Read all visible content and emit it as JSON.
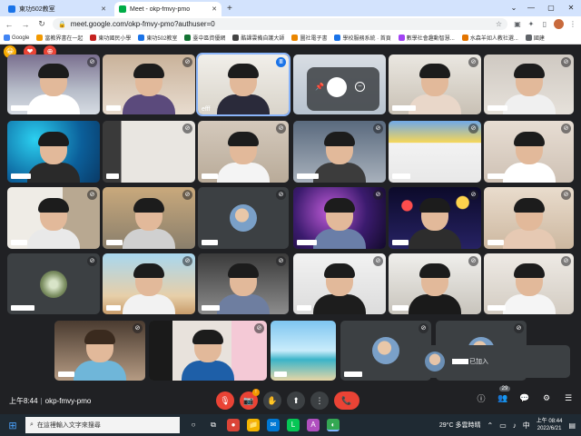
{
  "browser": {
    "tabs": [
      {
        "label": "東功502教室",
        "active": false,
        "icon_color": "#1a73e8"
      },
      {
        "label": "Meet - okp-fmvy-pmo",
        "active": true,
        "icon_color": "#00ac47"
      }
    ],
    "new_tab": "+",
    "window_controls": [
      "⌄",
      "—",
      "▢",
      "✕"
    ],
    "nav": {
      "back": "←",
      "forward": "→",
      "reload": "↻"
    },
    "url": "meet.google.com/okp-fmvy-pmo?authuser=0",
    "bookmarks": [
      {
        "label": "Google",
        "color": "#4285f4"
      },
      {
        "label": "當教界書在一起",
        "color": "#f29900"
      },
      {
        "label": "東功國民小學",
        "color": "#c5221f"
      },
      {
        "label": "東功502教室",
        "color": "#1a73e8"
      },
      {
        "label": "臺中區資優網",
        "color": "#137333"
      },
      {
        "label": "酷課雲備自護大師",
        "color": "#444"
      },
      {
        "label": "圖社電子書",
        "color": "#ea8600"
      },
      {
        "label": "學校服務系統 · 首頁",
        "color": "#1a73e8"
      },
      {
        "label": "數學社會趣動智慧...",
        "color": "#a142f4"
      },
      {
        "label": "水森羊如人教社選...",
        "color": "#e37400"
      },
      {
        "label": "國建",
        "color": "#5f6368"
      }
    ]
  },
  "meet": {
    "time": "上午8:44",
    "meeting_code": "okp-fmvy-pmo",
    "reactions": [
      "😀",
      "❤",
      "⊕"
    ],
    "name_visible": "efff",
    "participant_count": "29",
    "toast_text": "已加入",
    "controls": {
      "mic": "🎙",
      "camera": "📷",
      "camera_badge": "!",
      "hand": "✋",
      "present": "⬆",
      "more": "⋮",
      "end": "📞"
    },
    "right_controls": [
      "ⓘ",
      "👥",
      "💬",
      "⚙",
      "☰"
    ]
  },
  "taskbar": {
    "search_placeholder": "在這裡輸入文字來搜尋",
    "weather": "29°C 多雲時晴",
    "time": "上午 08:44",
    "date": "2022/6/21",
    "apps": [
      "○",
      "⧉",
      "●",
      "📁",
      "✉",
      "L",
      "A",
      "◐"
    ]
  }
}
